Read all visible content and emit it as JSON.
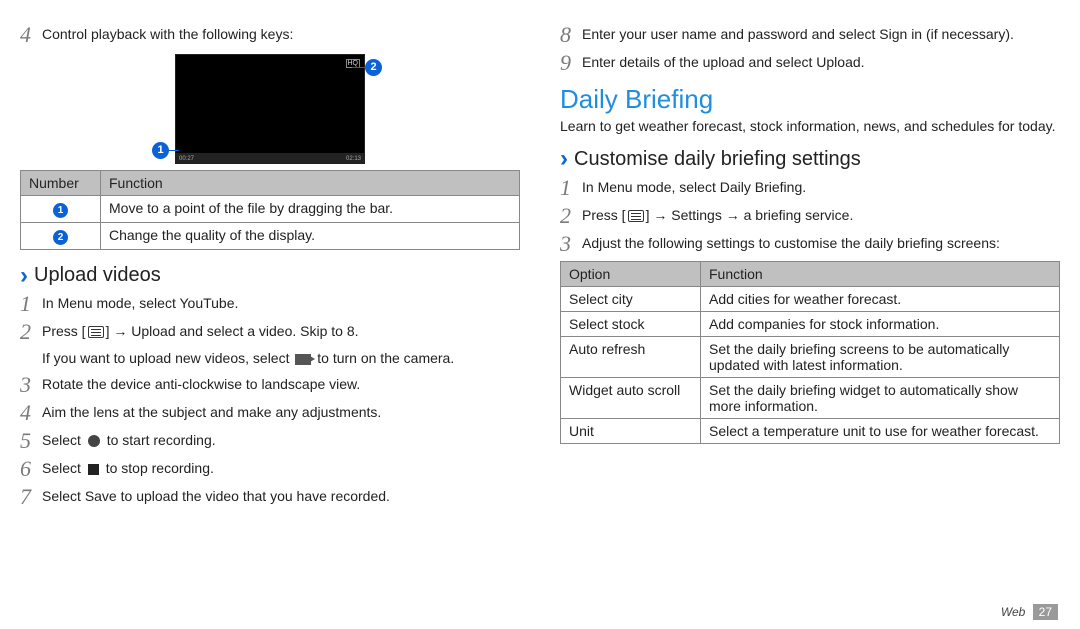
{
  "left": {
    "step4_intro": "Control playback with the following keys:",
    "thumb_hq": "HQ",
    "thumb_time_l": "00:27",
    "thumb_time_r": "02:13",
    "callout1": "1",
    "callout2": "2",
    "table1": {
      "head_number": "Number",
      "head_function": "Function",
      "rows": [
        {
          "num": "1",
          "func": "Move to a point of the file by dragging the bar."
        },
        {
          "num": "2",
          "func": "Change the quality of the display."
        }
      ]
    },
    "upload_heading": "Upload videos",
    "steps": {
      "s1_pre": "In Menu mode, select ",
      "s1_sel": "YouTube",
      "s1_post": ".",
      "s2_pre": "Press [",
      "s2_mid": "] → ",
      "s2_upload": "Upload",
      "s2_post": " and select a video. Skip to 8.",
      "s2_note_pre": "If you want to upload new videos, select ",
      "s2_note_post": " to turn on the camera.",
      "s3": "Rotate the device anti-clockwise to landscape view.",
      "s4": "Aim the lens at the subject and make any adjustments.",
      "s5_pre": "Select ",
      "s5_post": " to start recording.",
      "s6_pre": "Select ",
      "s6_post": " to stop recording.",
      "s7_pre": "Select ",
      "s7_save": "Save",
      "s7_post": " to upload the video that you have recorded."
    }
  },
  "right": {
    "step8_pre": "Enter your user name and password and select ",
    "step8_sel": "Sign in",
    "step8_post": " (if necessary).",
    "step9_pre": "Enter details of the upload and select ",
    "step9_sel": "Upload",
    "step9_post": ".",
    "h2": "Daily Briefing",
    "intro": "Learn to get weather forecast, stock information, news, and schedules for today.",
    "sub_h": "Customise daily briefing settings",
    "s1_pre": "In Menu mode, select ",
    "s1_sel": "Daily Briefing",
    "s1_post": ".",
    "s2_pre": "Press [",
    "s2_mid": "] → ",
    "s2_settings": "Settings",
    "s2_post": " → a briefing service.",
    "s3": "Adjust the following settings to customise the daily briefing screens:",
    "table2": {
      "head_option": "Option",
      "head_function": "Function",
      "rows": [
        {
          "opt": "Select city",
          "func": "Add cities for weather forecast."
        },
        {
          "opt": "Select stock",
          "func": "Add companies for stock information."
        },
        {
          "opt": "Auto refresh",
          "func": "Set the daily briefing screens to be automatically updated with latest information."
        },
        {
          "opt": "Widget auto scroll",
          "func": "Set the daily briefing widget to automatically show more information."
        },
        {
          "opt": "Unit",
          "func": "Select a temperature unit to use for weather forecast."
        }
      ]
    }
  },
  "footer": {
    "section": "Web",
    "page": "27"
  },
  "nums": {
    "n1": "1",
    "n2": "2",
    "n3": "3",
    "n4": "4",
    "n5": "5",
    "n6": "6",
    "n7": "7",
    "n8": "8",
    "n9": "9"
  }
}
